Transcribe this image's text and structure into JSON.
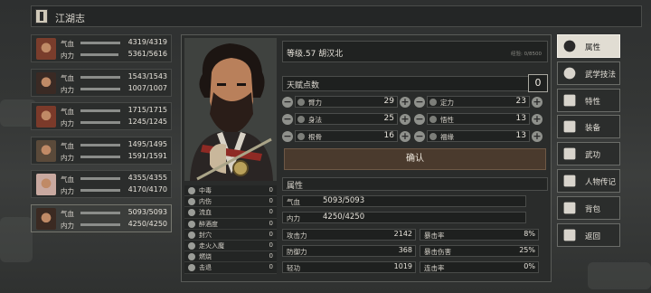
{
  "title": "江湖志",
  "roster": [
    {
      "hp_label": "气血",
      "hp": "4319/4319",
      "mp_label": "内力",
      "mp": "5361/5616",
      "hp_frac": 1.0,
      "mp_frac": 0.955,
      "active": false,
      "color": "#7a3d2c"
    },
    {
      "hp_label": "气血",
      "hp": "1543/1543",
      "mp_label": "内力",
      "mp": "1007/1007",
      "hp_frac": 1.0,
      "mp_frac": 1.0,
      "active": false,
      "color": "#3a2a24"
    },
    {
      "hp_label": "气血",
      "hp": "1715/1715",
      "mp_label": "内力",
      "mp": "1245/1245",
      "hp_frac": 1.0,
      "mp_frac": 1.0,
      "active": false,
      "color": "#7b3a2a"
    },
    {
      "hp_label": "气血",
      "hp": "1495/1495",
      "mp_label": "内力",
      "mp": "1591/1591",
      "hp_frac": 1.0,
      "mp_frac": 1.0,
      "active": false,
      "color": "#5a4a3a"
    },
    {
      "hp_label": "气血",
      "hp": "4355/4355",
      "mp_label": "内力",
      "mp": "4170/4170",
      "hp_frac": 1.0,
      "mp_frac": 1.0,
      "active": false,
      "color": "#c9a9a0"
    },
    {
      "hp_label": "气血",
      "hp": "5093/5093",
      "mp_label": "内力",
      "mp": "4250/4250",
      "hp_frac": 1.0,
      "mp_frac": 1.0,
      "active": true,
      "color": "#3b2a22"
    }
  ],
  "character": {
    "level_name": "等级.57  胡汉北",
    "exp": "经验: 0/8500"
  },
  "talent": {
    "label": "天赋点数",
    "value": "0"
  },
  "attributes": [
    {
      "name": "臂力",
      "value": "29"
    },
    {
      "name": "定力",
      "value": "23"
    },
    {
      "name": "身法",
      "value": "25"
    },
    {
      "name": "悟性",
      "value": "13"
    },
    {
      "name": "根骨",
      "value": "16"
    },
    {
      "name": "福缘",
      "value": "13"
    }
  ],
  "confirm_label": "确认",
  "section_title": "属性",
  "vitals": [
    {
      "name": "气血",
      "value": "5093/5093"
    },
    {
      "name": "内力",
      "value": "4250/4250"
    }
  ],
  "combat": [
    {
      "name": "攻击力",
      "value": "2142"
    },
    {
      "name": "暴击率",
      "value": "8%"
    },
    {
      "name": "防御力",
      "value": "368"
    },
    {
      "name": "暴击伤害",
      "value": "25%"
    },
    {
      "name": "轻功",
      "value": "1019"
    },
    {
      "name": "连击率",
      "value": "0%"
    }
  ],
  "statuses": [
    {
      "name": "中毒",
      "value": "0"
    },
    {
      "name": "内伤",
      "value": "0"
    },
    {
      "name": "流血",
      "value": "0"
    },
    {
      "name": "醉酒度",
      "value": "0"
    },
    {
      "name": "封穴",
      "value": "0"
    },
    {
      "name": "走火入魔",
      "value": "0"
    },
    {
      "name": "燃烧",
      "value": "0"
    },
    {
      "name": "击退",
      "value": "0"
    }
  ],
  "menu": [
    {
      "label": "属性",
      "icon": "character-icon",
      "active": true
    },
    {
      "label": "武学技法",
      "icon": "martial-skill-icon",
      "active": false
    },
    {
      "label": "特性",
      "icon": "trait-icon",
      "active": false
    },
    {
      "label": "装备",
      "icon": "sword-icon",
      "active": false
    },
    {
      "label": "武功",
      "icon": "manual-icon",
      "active": false
    },
    {
      "label": "人物传记",
      "icon": "biography-icon",
      "active": false
    },
    {
      "label": "背包",
      "icon": "bag-icon",
      "active": false
    },
    {
      "label": "返回",
      "icon": "return-icon",
      "active": false
    }
  ]
}
